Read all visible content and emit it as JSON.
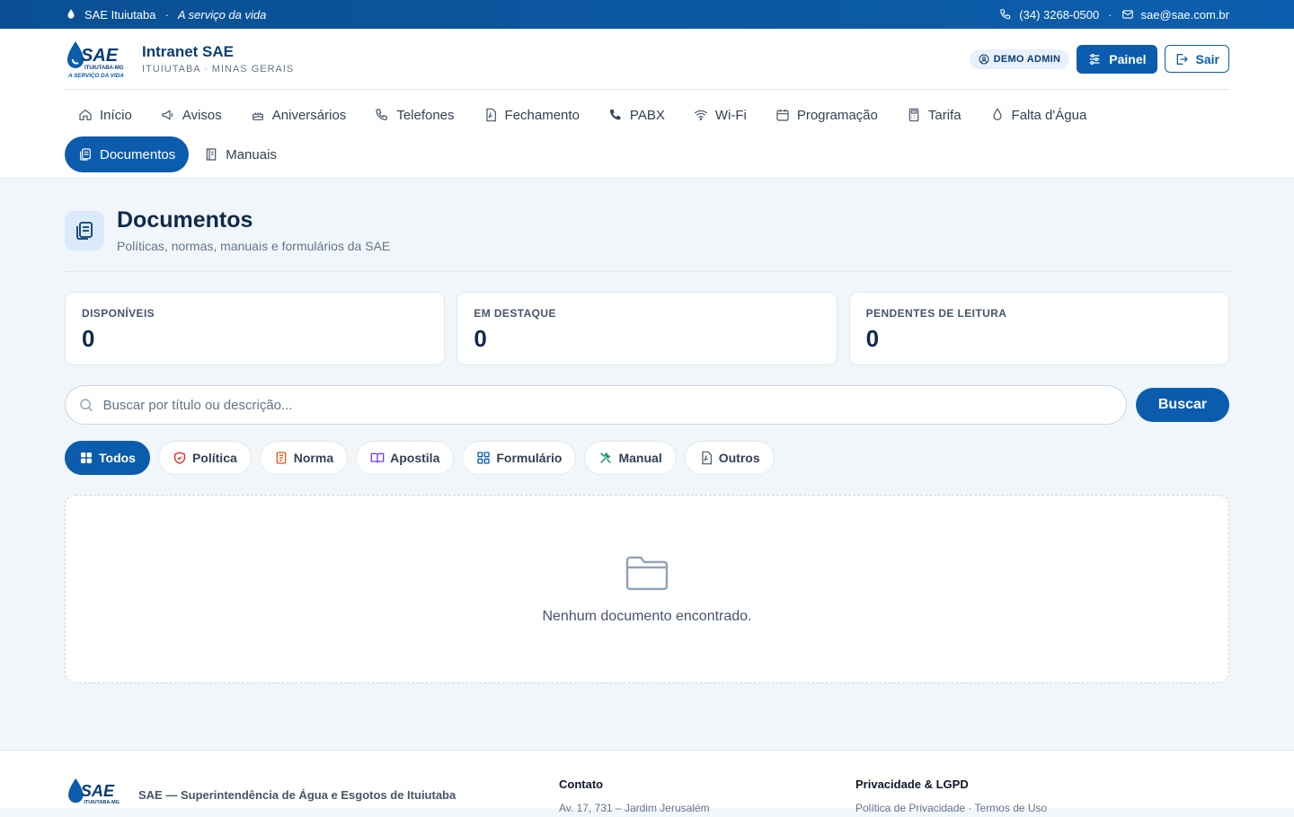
{
  "topbar": {
    "org": "SAE Ituiutaba",
    "slogan": "A serviço da vida",
    "phone": "(34) 3268-0500",
    "email": "sae@sae.com.br"
  },
  "brand": {
    "logo_text": "SAE",
    "logo_tag": "ITUIUTABA-MG",
    "logo_slogan": "A SERVIÇO DA VIDA",
    "title": "Intranet SAE",
    "subtitle": "ITUIUTABA · MINAS GERAIS"
  },
  "user": {
    "badge": "DEMO ADMIN",
    "painel_label": "Painel",
    "sair_label": "Sair"
  },
  "nav": [
    {
      "label": "Início",
      "icon": "home-icon"
    },
    {
      "label": "Avisos",
      "icon": "megaphone-icon"
    },
    {
      "label": "Aniversários",
      "icon": "cake-icon"
    },
    {
      "label": "Telefones",
      "icon": "phone-icon"
    },
    {
      "label": "Fechamento",
      "icon": "pdf-file-icon"
    },
    {
      "label": "PABX",
      "icon": "phone-filled-icon"
    },
    {
      "label": "Wi-Fi",
      "icon": "wifi-icon"
    },
    {
      "label": "Programação",
      "icon": "calendar-icon"
    },
    {
      "label": "Tarifa",
      "icon": "calculator-icon"
    },
    {
      "label": "Falta d'Água",
      "icon": "drop-icon"
    },
    {
      "label": "Documentos",
      "icon": "documents-icon",
      "active": true
    },
    {
      "label": "Manuais",
      "icon": "book-icon"
    }
  ],
  "page": {
    "title": "Documentos",
    "subtitle": "Políticas, normas, manuais e formulários da SAE"
  },
  "stats": [
    {
      "label": "DISPONÍVEIS",
      "value": "0"
    },
    {
      "label": "EM DESTAQUE",
      "value": "0"
    },
    {
      "label": "PENDENTES DE LEITURA",
      "value": "0"
    }
  ],
  "search": {
    "placeholder": "Buscar por título ou descrição...",
    "value": "",
    "button_label": "Buscar"
  },
  "filters": [
    {
      "label": "Todos",
      "icon": "grid-icon",
      "active": true
    },
    {
      "label": "Política",
      "icon": "shield-icon",
      "color": "#dc2626"
    },
    {
      "label": "Norma",
      "icon": "list-doc-icon",
      "color": "#ea580c"
    },
    {
      "label": "Apostila",
      "icon": "open-book-icon",
      "color": "#7c3aed"
    },
    {
      "label": "Formulário",
      "icon": "form-grid-icon",
      "color": "#0b5cad"
    },
    {
      "label": "Manual",
      "icon": "tools-icon",
      "color": "#059669"
    },
    {
      "label": "Outros",
      "icon": "file-icon",
      "color": "#475569"
    }
  ],
  "empty": {
    "message": "Nenhum documento encontrado."
  },
  "footer": {
    "org": "SAE — Superintendência de Água e Esgotos de Ituiutaba",
    "contact_title": "Contato",
    "contact_line": "Av. 17, 731 – Jardim Jerusalém",
    "privacy_title": "Privacidade & LGPD",
    "privacy_line": "Política de Privacidade · Termos de Uso"
  },
  "colors": {
    "primary": "#0b5cad",
    "topbar": "#0a4f93",
    "background": "#f1f6fa"
  }
}
